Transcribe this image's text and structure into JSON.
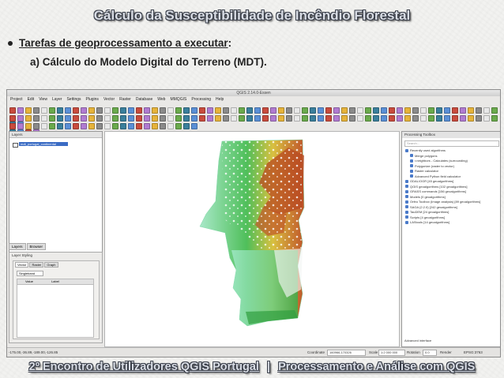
{
  "slide": {
    "title": "Cálculo da Susceptibilidade de Incêndio Florestal",
    "bullet_text": "Tarefas de geoprocessamento a executar",
    "bullet_colon": ":",
    "sub_item": "a) Cálculo do Modelo Digital do Terreno (MDT).",
    "footer_left": "2º Encontro de Utilizadores QGIS Portugal",
    "footer_sep": "|",
    "footer_right": "Processamento e Análise com QGIS"
  },
  "qgis": {
    "window_title": "QGIS 2.14.0-Essen",
    "menu": [
      "Project",
      "Edit",
      "View",
      "Layer",
      "Settings",
      "Plugins",
      "Vector",
      "Raster",
      "Database",
      "Web",
      "MMQGIS",
      "Processing",
      "Help"
    ],
    "layers_panel": {
      "title": "Layers",
      "layer_name": "mdt_portugal_continental"
    },
    "layer_tabs": [
      "Layers",
      "Browser"
    ],
    "style_panel": {
      "title": "Layer Styling",
      "tabs": [
        "Vector",
        "Raster",
        "Graph"
      ],
      "renderer": "Singleband",
      "columns": [
        "Value",
        "Label"
      ]
    },
    "processing": {
      "title": "Processing Toolbox",
      "search_placeholder": "Search...",
      "items": [
        "Recently used algorithms",
        "Merge polygons",
        "r.neighbors - Calculates (surrounding)",
        "Polygonize (raster to vector)",
        "Raster calculator",
        "Advanced Python field calculator",
        "GDAL/OGR [45 geoalgorithms]",
        "QGIS geoalgorithms [102 geoalgorithms]",
        "GRASS commands [156 geoalgorithms]",
        "Models [0 geoalgorithms]",
        "Orfeo Toolbox (Image analysis) [89 geoalgorithms]",
        "SAGA (2.2.0) [242 geoalgorithms]",
        "TauDEM [24 geoalgorithms]",
        "Scripts [4 geoalgorithms]",
        "LAStools [14 geoalgorithms]"
      ],
      "footer": "Advanced interface"
    },
    "status": {
      "coord_left": "-175.00,-36.89,-189.00,-126.85",
      "coordinate_label": "Coordinate",
      "coordinate_value": "160966,170326",
      "scale_label": "Scale",
      "scale_value": "1:2 000 000",
      "rotation_label": "Rotation",
      "rotation_value": "0.0",
      "render_label": "Render",
      "crs": "EPSG:3763"
    }
  }
}
